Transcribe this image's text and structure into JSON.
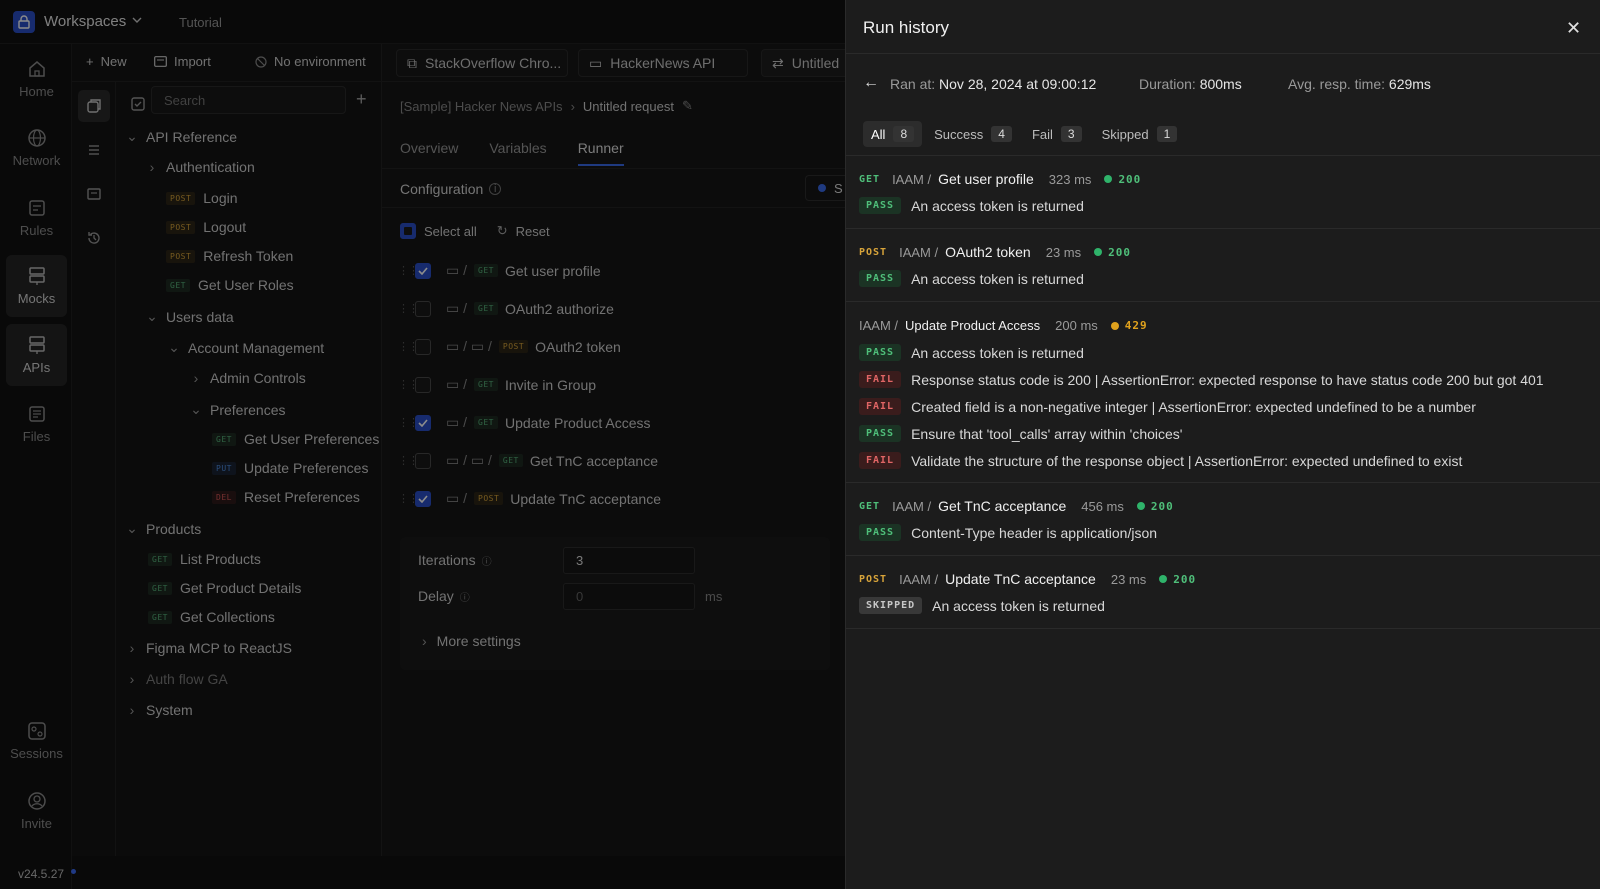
{
  "topbar": {
    "workspace": "Workspaces",
    "tutorial": "Tutorial"
  },
  "rail": {
    "items": [
      {
        "label": "Home",
        "icon": "home-icon"
      },
      {
        "label": "Network",
        "icon": "globe-icon"
      },
      {
        "label": "Rules",
        "icon": "rules-icon"
      },
      {
        "label": "Mocks",
        "icon": "server-icon"
      },
      {
        "label": "APIs",
        "icon": "server-icon"
      },
      {
        "label": "Files",
        "icon": "files-icon"
      },
      {
        "label": "Sessions",
        "icon": "sessions-icon"
      },
      {
        "label": "Invite",
        "icon": "invite-icon"
      }
    ],
    "version": "v24.5.27"
  },
  "sidebar": {
    "new_label": "New",
    "import_label": "Import",
    "env_label": "No environment",
    "search_placeholder": "Search",
    "tree": [
      {
        "label": "API Reference"
      },
      {
        "label": "Authentication"
      },
      {
        "label": "Login",
        "method": "POST"
      },
      {
        "label": "Logout",
        "method": "POST"
      },
      {
        "label": "Refresh Token",
        "method": "POST"
      },
      {
        "label": "Get User Roles",
        "method": "GET"
      },
      {
        "label": "Users data"
      },
      {
        "label": "Account Management"
      },
      {
        "label": "Admin Controls"
      },
      {
        "label": "Preferences"
      },
      {
        "label": "Get User Preferences",
        "method": "GET"
      },
      {
        "label": "Update Preferences",
        "method": "PUT"
      },
      {
        "label": "Reset Preferences",
        "method": "DEL"
      },
      {
        "label": "Products"
      },
      {
        "label": "List Products",
        "method": "GET"
      },
      {
        "label": "Get Product Details",
        "method": "GET"
      },
      {
        "label": "Get Collections",
        "method": "GET"
      },
      {
        "label": "Figma MCP to ReactJS"
      },
      {
        "label": "Auth flow GA"
      },
      {
        "label": "System"
      }
    ]
  },
  "main": {
    "tabs": [
      "StackOverflow Chro...",
      "HackerNews API",
      "Untitled"
    ],
    "breadcrumb": {
      "parent": "[Sample] Hacker News APIs",
      "current": "Untitled request"
    },
    "subtabs": [
      "Overview",
      "Variables",
      "Runner"
    ],
    "config_title": "Configuration",
    "run_button_partial": "S",
    "select_all": "Select all",
    "reset": "Reset",
    "requests": [
      {
        "name": "Get user profile",
        "method": "GET",
        "checked": true
      },
      {
        "name": "OAuth2 authorize",
        "method": "GET",
        "checked": false
      },
      {
        "name": "OAuth2 token",
        "method": "POST",
        "checked": false
      },
      {
        "name": "Invite in Group",
        "method": "GET",
        "checked": false
      },
      {
        "name": "Update Product Access",
        "method": "GET",
        "checked": true
      },
      {
        "name": "Get TnC acceptance",
        "method": "GET",
        "checked": false
      },
      {
        "name": "Update TnC acceptance",
        "method": "POST",
        "checked": true
      }
    ],
    "iterations_label": "Iterations",
    "iterations_value": "3",
    "delay_label": "Delay",
    "delay_placeholder": "0",
    "delay_unit": "ms",
    "more_settings": "More settings"
  },
  "run_history": {
    "title": "Run history",
    "ran_at_label": "Ran at:",
    "ran_at": "Nov 28, 2024 at 09:00:12",
    "duration_label": "Duration:",
    "duration": "800ms",
    "avg_label": "Avg. resp. time:",
    "avg": "629ms",
    "filters": [
      {
        "label": "All",
        "count": "8"
      },
      {
        "label": "Success",
        "count": "4"
      },
      {
        "label": "Fail",
        "count": "3"
      },
      {
        "label": "Skipped",
        "count": "1"
      }
    ],
    "results": [
      {
        "method": "GET",
        "path": "IAAM /",
        "name": "Get user profile",
        "duration": "323 ms",
        "status": "200",
        "status_color": "#2fb36a",
        "assertions": [
          {
            "result": "PASS",
            "text": "An access token is returned"
          }
        ]
      },
      {
        "method": "POST",
        "path": "IAAM /",
        "name": "OAuth2 token",
        "duration": "23 ms",
        "status": "200",
        "status_color": "#2fb36a",
        "assertions": [
          {
            "result": "PASS",
            "text": "An access token is returned"
          }
        ]
      },
      {
        "method": "",
        "path": "IAAM /",
        "name": "Update Product Access",
        "duration": "200 ms",
        "status": "429",
        "status_color": "#e0a21d",
        "assertions": [
          {
            "result": "PASS",
            "text": "An access token is returned"
          },
          {
            "result": "FAIL",
            "text": "Response status code is 200 | AssertionError: expected response to have status code 200 but got 401"
          },
          {
            "result": "FAIL",
            "text": "Created field is a non-negative integer | AssertionError: expected undefined to be a number"
          },
          {
            "result": "PASS",
            "text": "Ensure that 'tool_calls' array within 'choices'"
          },
          {
            "result": "FAIL",
            "text": "Validate the structure of the response object | AssertionError: expected undefined to exist"
          }
        ]
      },
      {
        "method": "GET",
        "path": "IAAM /",
        "name": "Get TnC acceptance",
        "duration": "456 ms",
        "status": "200",
        "status_color": "#2fb36a",
        "assertions": [
          {
            "result": "PASS",
            "text": "Content-Type header is application/json"
          }
        ]
      },
      {
        "method": "POST",
        "path": "IAAM /",
        "name": "Update TnC acceptance",
        "duration": "23 ms",
        "status": "200",
        "status_color": "#2fb36a",
        "assertions": [
          {
            "result": "SKIPPED",
            "text": "An access token is returned"
          }
        ]
      }
    ]
  }
}
